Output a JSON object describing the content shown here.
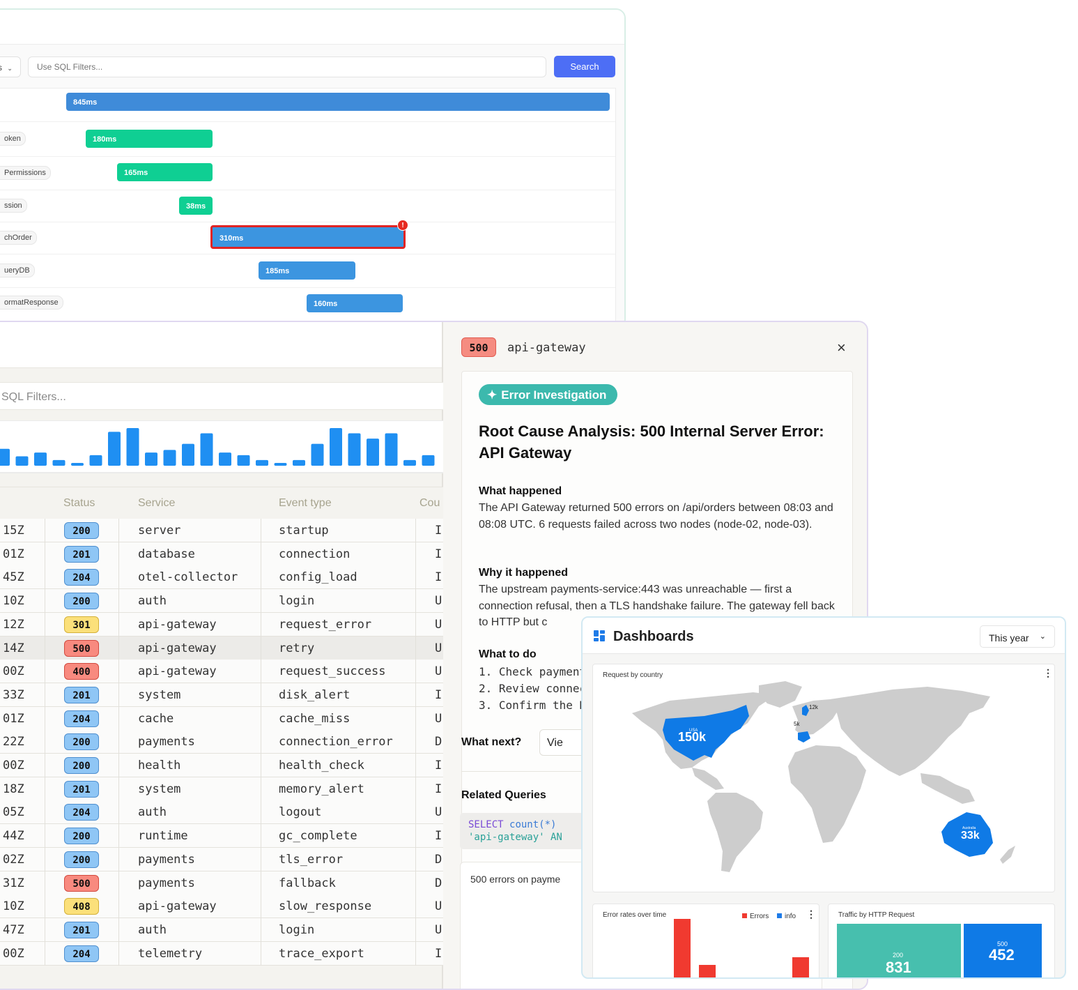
{
  "trace": {
    "dropdown_label": "s",
    "sql_placeholder": "Use SQL Filters...",
    "search_label": "Search",
    "spans": [
      {
        "label": "",
        "duration": "845ms"
      },
      {
        "label": "oken",
        "duration": "180ms"
      },
      {
        "label": "Permissions",
        "duration": "165ms"
      },
      {
        "label": "ssion",
        "duration": "38ms"
      },
      {
        "label": "chOrder",
        "duration": "310ms",
        "error_marker": "!"
      },
      {
        "label": "ueryDB",
        "duration": "185ms"
      },
      {
        "label": "ormatResponse",
        "duration": "160ms"
      }
    ]
  },
  "logs": {
    "sql_placeholder": "SQL Filters...",
    "histogram": [
      0.45,
      0.25,
      0.35,
      0.15,
      0.06,
      0.28,
      0.9,
      1.0,
      0.35,
      0.42,
      0.58,
      0.86,
      0.35,
      0.28,
      0.15,
      0.06,
      0.15,
      0.58,
      1.0,
      0.86,
      0.72,
      0.86,
      0.15,
      0.28
    ],
    "columns": {
      "status": "Status",
      "service": "Service",
      "event_type": "Event type",
      "count": "Cou"
    },
    "rows": [
      {
        "time": "15Z",
        "status": "200",
        "service": "server",
        "event": "startup",
        "col": "I"
      },
      {
        "time": "01Z",
        "status": "201",
        "service": "database",
        "event": "connection",
        "col": "I"
      },
      {
        "time": "45Z",
        "status": "204",
        "service": "otel-collector",
        "event": "config_load",
        "col": "I"
      },
      {
        "time": "10Z",
        "status": "200",
        "service": "auth",
        "event": "login",
        "col": "U"
      },
      {
        "time": "12Z",
        "status": "301",
        "service": "api-gateway",
        "event": "request_error",
        "col": "U"
      },
      {
        "time": "14Z",
        "status": "500",
        "service": "api-gateway",
        "event": "retry",
        "col": "U"
      },
      {
        "time": "00Z",
        "status": "400",
        "service": "api-gateway",
        "event": "request_success",
        "col": "U"
      },
      {
        "time": "33Z",
        "status": "201",
        "service": "system",
        "event": "disk_alert",
        "col": "I"
      },
      {
        "time": "01Z",
        "status": "204",
        "service": "cache",
        "event": "cache_miss",
        "col": "U"
      },
      {
        "time": "22Z",
        "status": "200",
        "service": "payments",
        "event": "connection_error",
        "col": "D"
      },
      {
        "time": "00Z",
        "status": "200",
        "service": "health",
        "event": "health_check",
        "col": "I"
      },
      {
        "time": "18Z",
        "status": "201",
        "service": "system",
        "event": "memory_alert",
        "col": "I"
      },
      {
        "time": "05Z",
        "status": "204",
        "service": "auth",
        "event": "logout",
        "col": "U"
      },
      {
        "time": "44Z",
        "status": "200",
        "service": "runtime",
        "event": "gc_complete",
        "col": "I"
      },
      {
        "time": "02Z",
        "status": "200",
        "service": "payments",
        "event": "tls_error",
        "col": "D"
      },
      {
        "time": "31Z",
        "status": "500",
        "service": "payments",
        "event": "fallback",
        "col": "D"
      },
      {
        "time": "10Z",
        "status": "408",
        "service": "api-gateway",
        "event": "slow_response",
        "col": "U"
      },
      {
        "time": "47Z",
        "status": "201",
        "service": "auth",
        "event": "login",
        "col": "U"
      },
      {
        "time": "00Z",
        "status": "204",
        "service": "telemetry",
        "event": "trace_export",
        "col": "I"
      }
    ]
  },
  "detail": {
    "status": "500",
    "service": "api-gateway",
    "close_glyph": "×",
    "pill_label": "Error Investigation",
    "title": "Root Cause Analysis: 500 Internal Server Error: API Gateway",
    "what_happened_h": "What happened",
    "what_happened": "The API Gateway returned 500 errors on /api/orders between 08:03 and 08:08 UTC. 6 requests failed across two nodes (node-02, node-03).",
    "why_h": "Why it happened",
    "why": "The upstream payments-service:443 was unreachable — first a connection refusal, then a TLS handshake failure. The gateway fell back to HTTP but c",
    "todo_h": "What to do",
    "todo": [
      "1. Check payment",
      "2. Review connect",
      "3. Confirm the HTT"
    ],
    "what_next": "What next?",
    "view_label": "Vie",
    "related_h": "Related Queries",
    "query_line1_kw": "SELECT",
    "query_line1_fn": "count(*)",
    "query_line2": "'api-gateway' AN",
    "result_title": "500 errors on payme"
  },
  "dash": {
    "title": "Dashboards",
    "range": "This year",
    "map_title": "Request by country",
    "map_labels": [
      {
        "country": "USA",
        "value": "150k"
      },
      {
        "country": "Australia",
        "value": "33k"
      },
      {
        "country": "",
        "value": "12k"
      },
      {
        "country": "",
        "value": "5k"
      }
    ],
    "err_title": "Error rates over time",
    "legend": [
      {
        "name": "Errors",
        "color": "#f03a30"
      },
      {
        "name": "info",
        "color": "#1e7be8"
      }
    ],
    "err_bars": [
      {
        "errors": 0.8,
        "info": 0.1
      },
      {
        "errors": 0.3,
        "info": 0.0
      },
      {
        "errors": 0.0,
        "info": 0.0
      },
      {
        "errors": 0.05,
        "info": 0.0
      },
      {
        "errors": 0.3,
        "info": 0.1
      }
    ],
    "traffic_title": "Traffic by HTTP Request",
    "traffic": [
      {
        "code": "200",
        "count": "831",
        "color": "#47bfae"
      },
      {
        "code": "500",
        "count": "452",
        "color": "#0f7ae6"
      }
    ],
    "colors": {
      "map_land": "#cdcdcd",
      "map_highlight": "#0f7ae6"
    }
  }
}
